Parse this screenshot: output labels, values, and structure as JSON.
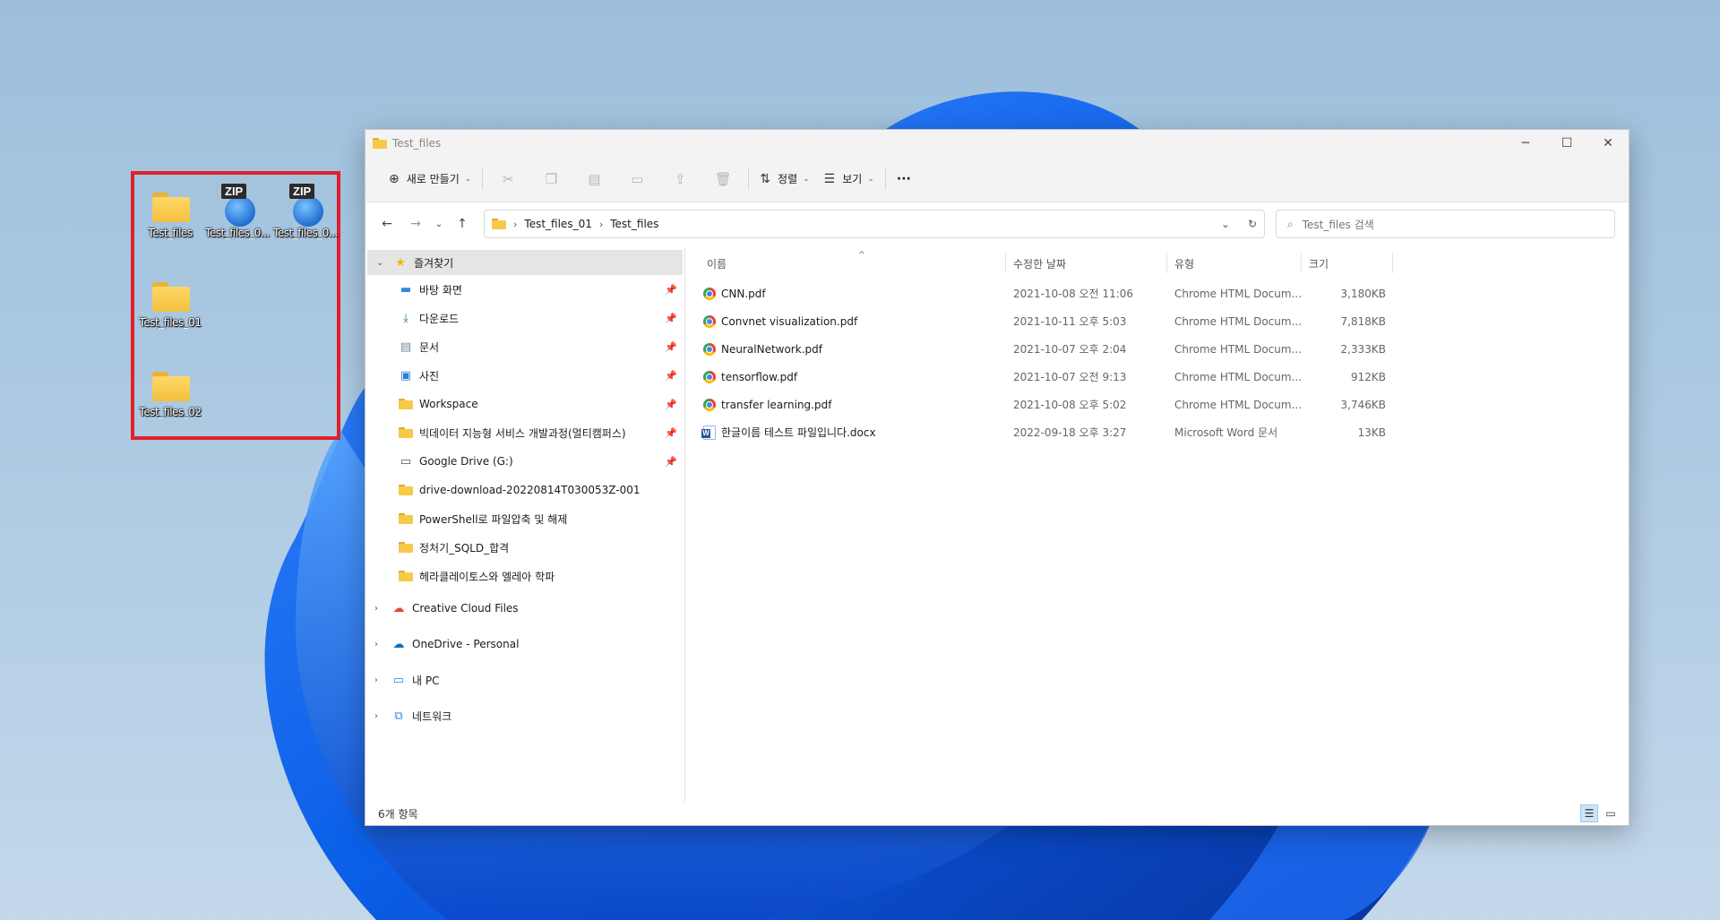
{
  "desktop": {
    "icons": [
      {
        "label": "Test_files",
        "icon": "folder-icon"
      },
      {
        "label": "Test_files_0...",
        "icon": "zip-archive-icon",
        "badge": "ZIP"
      },
      {
        "label": "Test_files_0...",
        "icon": "zip-archive-icon",
        "badge": "ZIP"
      },
      {
        "label": "Test_files_01",
        "icon": "folder-icon"
      },
      {
        "label": "Test_files_02",
        "icon": "folder-icon"
      }
    ],
    "highlight_color": "#e0202c"
  },
  "window": {
    "title": "Test_files",
    "controls": {
      "minimize": "─",
      "maximize": "☐",
      "close": "✕"
    }
  },
  "toolbar": {
    "new_label": "새로 만들기",
    "sort_label": "정렬",
    "view_label": "보기",
    "more_label": "···"
  },
  "address": {
    "crumbs": [
      "Test_files_01",
      "Test_files"
    ]
  },
  "search": {
    "placeholder": "Test_files 검색"
  },
  "nav": {
    "favorites_label": "즐겨찾기",
    "quick_access": [
      {
        "label": "바탕 화면",
        "icon": "desktop-icon",
        "pinned": true
      },
      {
        "label": "다운로드",
        "icon": "download-icon",
        "pinned": true
      },
      {
        "label": "문서",
        "icon": "document-icon",
        "pinned": true
      },
      {
        "label": "사진",
        "icon": "pictures-icon",
        "pinned": true
      },
      {
        "label": "Workspace",
        "icon": "folder-icon",
        "pinned": true
      },
      {
        "label": "빅데이터 지능형 서비스 개발과정(멀티캠퍼스)",
        "icon": "folder-icon",
        "pinned": true
      },
      {
        "label": "Google Drive (G:)",
        "icon": "drive-icon",
        "pinned": true
      },
      {
        "label": "drive-download-20220814T030053Z-001",
        "icon": "folder-icon",
        "pinned": false
      },
      {
        "label": "PowerShell로 파일압축 및 해제",
        "icon": "folder-icon",
        "pinned": false
      },
      {
        "label": "정처기_SQLD_합격",
        "icon": "folder-icon",
        "pinned": false
      },
      {
        "label": "헤라클레이토스와 엘레아 학파",
        "icon": "folder-icon",
        "pinned": false
      }
    ],
    "roots": [
      {
        "label": "Creative Cloud Files",
        "icon": "creative-cloud-icon"
      },
      {
        "label": "OneDrive - Personal",
        "icon": "onedrive-icon"
      },
      {
        "label": "내 PC",
        "icon": "pc-icon"
      },
      {
        "label": "네트워크",
        "icon": "network-icon"
      }
    ]
  },
  "columns": {
    "name": "이름",
    "date": "수정한 날짜",
    "type": "유형",
    "size": "크기"
  },
  "files": [
    {
      "name": "CNN.pdf",
      "date": "2021-10-08 오전 11:06",
      "type": "Chrome HTML Docum...",
      "size": "3,180KB",
      "icon": "chrome-icon"
    },
    {
      "name": "Convnet visualization.pdf",
      "date": "2021-10-11 오후 5:03",
      "type": "Chrome HTML Docum...",
      "size": "7,818KB",
      "icon": "chrome-icon"
    },
    {
      "name": "NeuralNetwork.pdf",
      "date": "2021-10-07 오후 2:04",
      "type": "Chrome HTML Docum...",
      "size": "2,333KB",
      "icon": "chrome-icon"
    },
    {
      "name": "tensorflow.pdf",
      "date": "2021-10-07 오전 9:13",
      "type": "Chrome HTML Docum...",
      "size": "912KB",
      "icon": "chrome-icon"
    },
    {
      "name": "transfer learning.pdf",
      "date": "2021-10-08 오후 5:02",
      "type": "Chrome HTML Docum...",
      "size": "3,746KB",
      "icon": "chrome-icon"
    },
    {
      "name": "한글이름 테스트 파일입니다.docx",
      "date": "2022-09-18 오후 3:27",
      "type": "Microsoft Word 문서",
      "size": "13KB",
      "icon": "word-icon"
    }
  ],
  "status": {
    "item_count": "6개 항목"
  }
}
